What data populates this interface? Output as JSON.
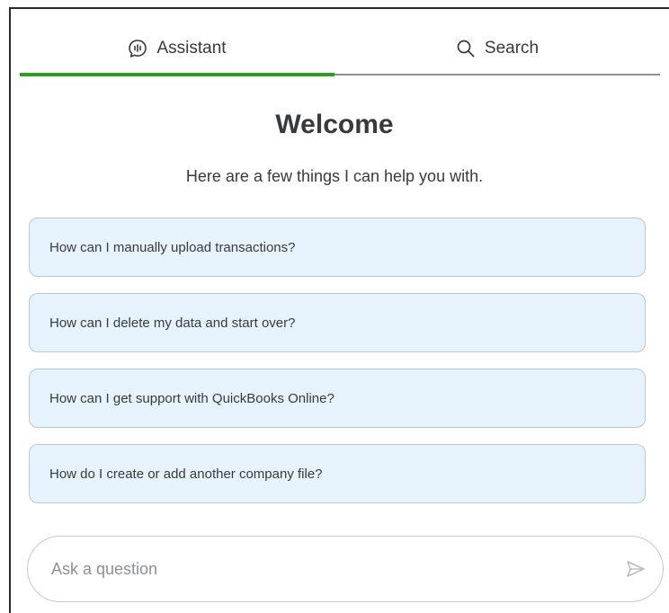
{
  "tabs": {
    "assistant": {
      "label": "Assistant",
      "icon": "chat-bubble-icon",
      "active": true
    },
    "search": {
      "label": "Search",
      "icon": "search-icon",
      "active": false
    }
  },
  "colors": {
    "active_tab": "#2ca01c",
    "suggestion_bg": "#e6f3fc",
    "suggestion_border": "#b7c9d6",
    "text": "#393a3d"
  },
  "welcome": {
    "title": "Welcome",
    "subtitle": "Here are a few things I can help you with."
  },
  "suggestions": [
    "How can I manually upload transactions?",
    "How can I delete my data and start over?",
    "How can I get support with QuickBooks Online?",
    "How do I create or add another company file?"
  ],
  "ask": {
    "placeholder": "Ask a question",
    "send_icon": "send-icon"
  }
}
